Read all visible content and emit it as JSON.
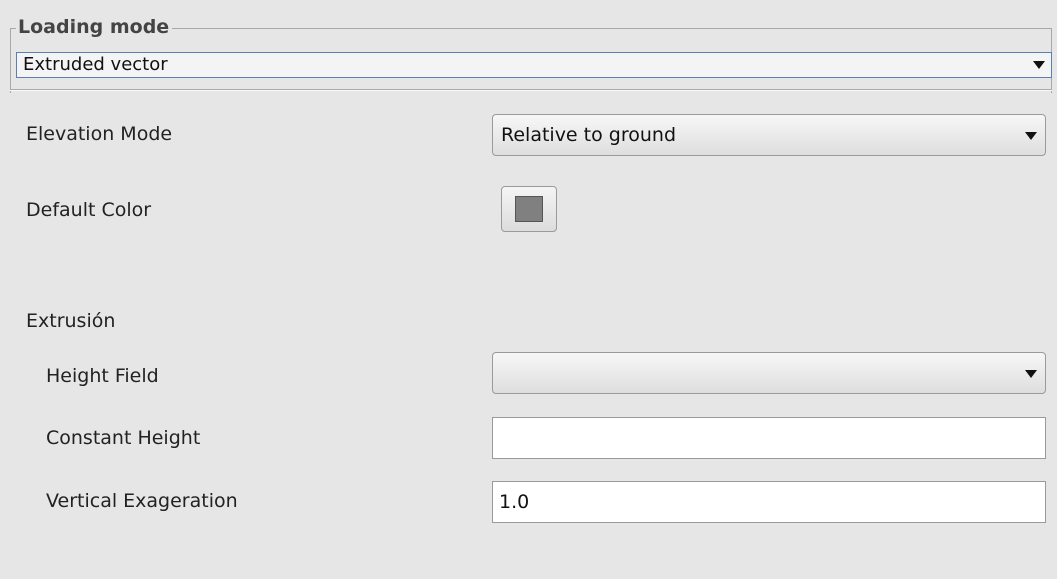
{
  "loading_mode": {
    "title": "Loading mode",
    "selected": "Extruded vector"
  },
  "elevation_mode": {
    "label": "Elevation Mode",
    "selected": "Relative to ground"
  },
  "default_color": {
    "label": "Default Color",
    "color": "#808080"
  },
  "extrusion": {
    "label": "Extrusión",
    "height_field": {
      "label": "Height Field",
      "selected": ""
    },
    "constant_height": {
      "label": "Constant Height",
      "value": ""
    },
    "vertical_exageration": {
      "label": "Vertical Exageration",
      "value": "1.0"
    }
  }
}
